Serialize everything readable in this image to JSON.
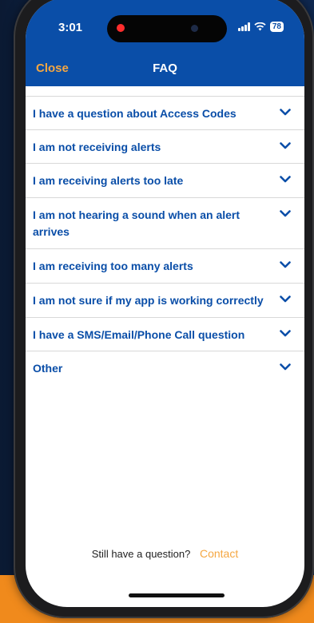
{
  "status": {
    "time": "3:01",
    "battery": "78"
  },
  "header": {
    "close_label": "Close",
    "title": "FAQ"
  },
  "faq": [
    {
      "question": "I have a question about Access Codes"
    },
    {
      "question": "I am not receiving alerts"
    },
    {
      "question": "I am receiving alerts too late"
    },
    {
      "question": "I am not hearing a sound when an alert arrives"
    },
    {
      "question": "I am receiving too many alerts"
    },
    {
      "question": "I am not sure if my app is working correctly"
    },
    {
      "question": "I have a SMS/Email/Phone Call question"
    },
    {
      "question": "Other"
    }
  ],
  "footer": {
    "prompt": "Still have a question?",
    "contact_label": "Contact"
  },
  "colors": {
    "header": "#0a4ea8",
    "accent": "#f5a742",
    "text": "#0a4ea8"
  }
}
